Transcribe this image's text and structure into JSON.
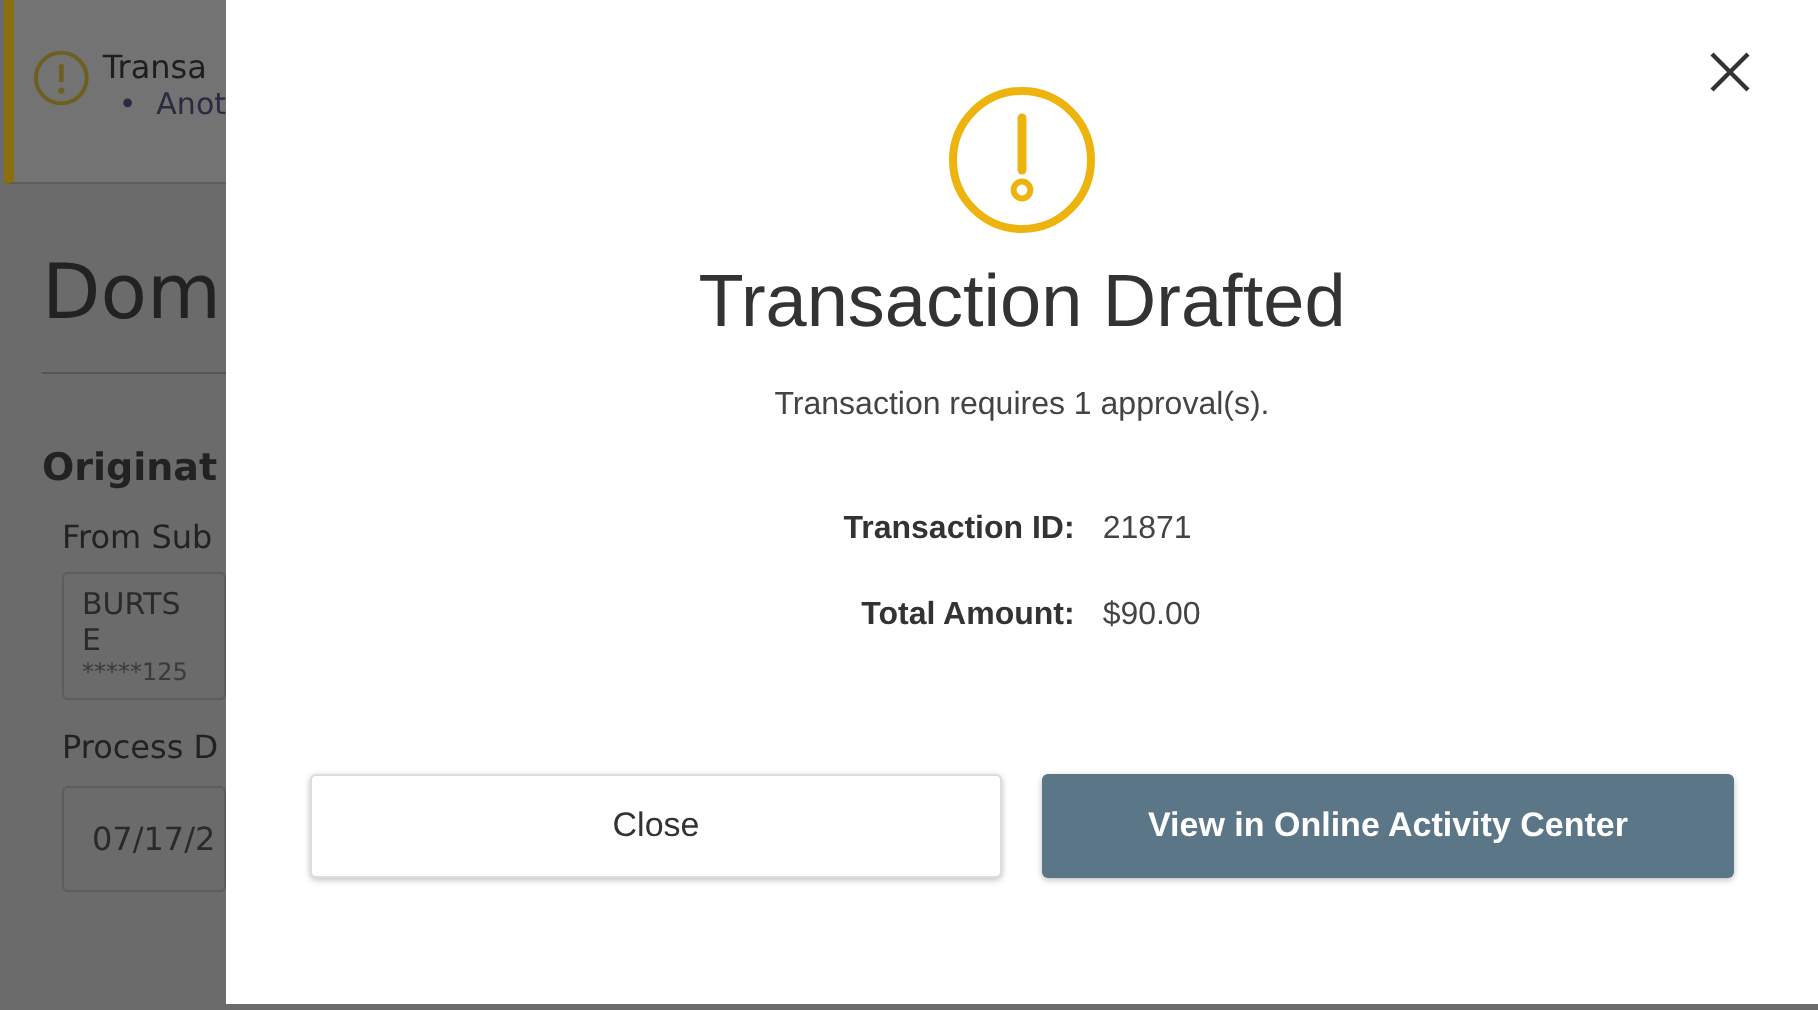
{
  "background": {
    "alert": {
      "title": "Transa",
      "bullet": "•",
      "item": "Anot"
    },
    "heading": "Dom",
    "section": "Originat",
    "from_label": "From Sub",
    "account_name": "BURTS E",
    "account_number": "*****125",
    "date_label": "Process D",
    "date_value": "07/17/2"
  },
  "dialog": {
    "title": "Transaction Drafted",
    "message": "Transaction requires 1 approval(s).",
    "details": [
      {
        "label": "Transaction ID:",
        "value": "21871"
      },
      {
        "label": "Total Amount:",
        "value": "$90.00"
      }
    ],
    "buttons": [
      {
        "label": "Close",
        "kind": "secondary"
      },
      {
        "label": "View in Online Activity Center",
        "kind": "primary"
      }
    ]
  }
}
